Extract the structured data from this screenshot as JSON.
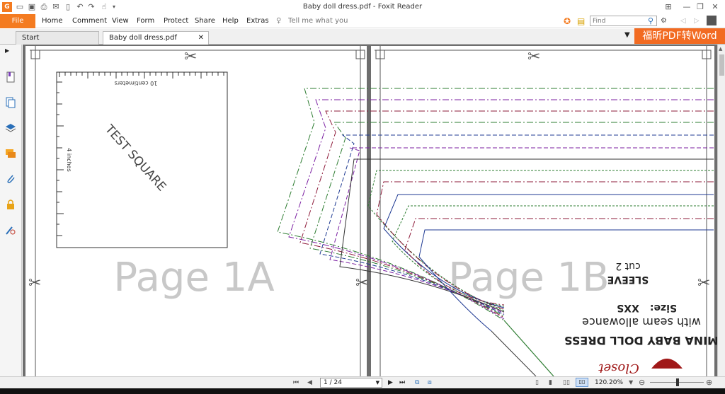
{
  "window": {
    "title": "Baby doll dress.pdf - Foxit Reader"
  },
  "menu": {
    "file": "File",
    "items": [
      "Home",
      "Comment",
      "View",
      "Form",
      "Protect",
      "Share",
      "Help",
      "Extras"
    ],
    "tell_me": "Tell me what you wa"
  },
  "search": {
    "placeholder": "Find"
  },
  "tabs": [
    {
      "label": "Start"
    },
    {
      "label": "Baby doll dress.pdf"
    }
  ],
  "promo": {
    "label": "福昕PDF转Word"
  },
  "page_a": {
    "label": "Page 1A",
    "test_square": "TEST SQUARE",
    "ruler_top": "10 centimeters",
    "ruler_left": "4 inches"
  },
  "page_b": {
    "label": "Page 1B",
    "title": "MINA BABY DOLL DRESS",
    "subtitle": "with seam allowance",
    "size": "Size:",
    "size_value": "XXS",
    "piece": "SLEEVE",
    "cut": "cut 2",
    "logo": "Closet"
  },
  "status": {
    "page": "1 / 24",
    "zoom": "120.20%"
  },
  "colors": {
    "accent": "#f47b20",
    "promo": "#f26b22",
    "pattern_green": "#2e7d32",
    "pattern_purple": "#7b1fa2",
    "pattern_red": "#8e1b3a",
    "pattern_blue": "#1f3a93"
  }
}
